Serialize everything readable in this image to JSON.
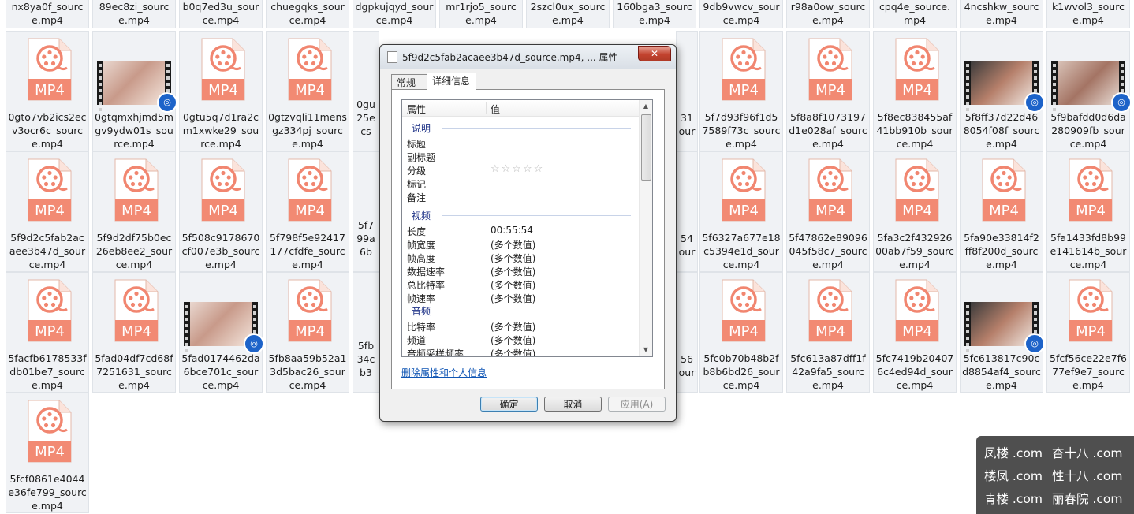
{
  "top_row": [
    "nx8ya0f_source.mp4",
    "89ec8zi_source.mp4",
    "b0q7ed3u_source.mp4",
    "chuegqks_source.mp4",
    "dgpkujqyd_source.mp4",
    "mr1rjo5_source.mp4",
    "2szcl0ux_source.mp4",
    "160bga3_source.mp4",
    "9db9vwcv_source.mp4",
    "r98a0ow_source.mp4",
    "cpq4e_source.mp4",
    "4ncshkw_source.mp4",
    "k1wvol3_source.mp4"
  ],
  "row1": [
    "0gto7vb2ics2ecv3ocr6c_source.mp4",
    "0gtqmxhjmd5mgv9ydw01s_source.mp4",
    "0gtu5q7d1ra2cm1xwke29_source.mp4",
    "0gtzvqli11mensgz334pj_source.mp4",
    "0gu25ecs",
    "",
    "",
    "",
    "31 our",
    "5f7d93f96f1d57589f73c_source.mp4",
    "5f8a8f1073197d1e028af_source.mp4",
    "5f8ec838455af41bb910b_source.mp4",
    "5f8ff37d22d468054f08f_source.mp4",
    "5f9bafdd0d6da280909fb_source.mp4"
  ],
  "row2": [
    "5f9d2c5fab2acaee3b47d_source.mp4",
    "5f9d2df75b0ec26eb8ee2_source.mp4",
    "5f508c9178670cf007e3b_source.mp4",
    "5f798f5e92417177cfdfe_source.mp4",
    "5f799a6b",
    "",
    "",
    "",
    "54 our",
    "5f6327a677e18c5394e1d_source.mp4",
    "5f47862e89096045f58c7_source.mp4",
    "5fa3c2f43292600ab7f59_source.mp4",
    "5fa90e33814f2ff8f200d_source.mp4",
    "5fa1433fd8b99e141614b_source.mp4"
  ],
  "row3": [
    "5facfb6178533fdb01be7_source.mp4",
    "5fad04df7cd68f7251631_source.mp4",
    "5fad0174462da6bce701c_source.mp4",
    "5fb8aa59b52a13d5bac26_source.mp4",
    "5fb34cb3",
    "",
    "",
    "",
    "56 our",
    "5fc0b70b48b2fb8b6bd26_source.mp4",
    "5fc613a87dff1f42a9fa5_source.mp4",
    "5fc7419b204076c4ed94d_source.mp4",
    "5fc613817c90cd8854af4_source.mp4",
    "5fcf56ce22e7f677ef9e7_source.mp4"
  ],
  "row4": [
    "5fcf0861e4044e36fe799_source.mp4"
  ],
  "mp4_label": "MP4",
  "dialog": {
    "title": "5f9d2c5fab2acaee3b47d_source.mp4, ... 属性",
    "close": "✕",
    "tabs": [
      "常规",
      "详细信息"
    ],
    "col_property": "属性",
    "col_value": "值",
    "groups": {
      "description": "说明",
      "video": "视频",
      "audio": "音频"
    },
    "desc_rows": [
      "标题",
      "副标题",
      "分级",
      "标记",
      "备注"
    ],
    "rating_stars": "☆☆☆☆☆",
    "video_rows": [
      {
        "k": "长度",
        "v": "00:55:54"
      },
      {
        "k": "帧宽度",
        "v": "(多个数值)"
      },
      {
        "k": "帧高度",
        "v": "(多个数值)"
      },
      {
        "k": "数据速率",
        "v": "(多个数值)"
      },
      {
        "k": "总比特率",
        "v": "(多个数值)"
      },
      {
        "k": "帧速率",
        "v": "(多个数值)"
      }
    ],
    "audio_rows": [
      {
        "k": "比特率",
        "v": "(多个数值)"
      },
      {
        "k": "频道",
        "v": "(多个数值)"
      },
      {
        "k": "音频采样频率",
        "v": "(多个数值)"
      }
    ],
    "remove_link": "删除属性和个人信息",
    "ok": "确定",
    "cancel": "取消",
    "apply": "应用(A)"
  },
  "watermark": [
    [
      "凤楼 .com",
      "杏十八 .com"
    ],
    [
      "楼凤 .com",
      "性十八 .com"
    ],
    [
      "青楼 .com",
      "丽春院 .com"
    ]
  ]
}
